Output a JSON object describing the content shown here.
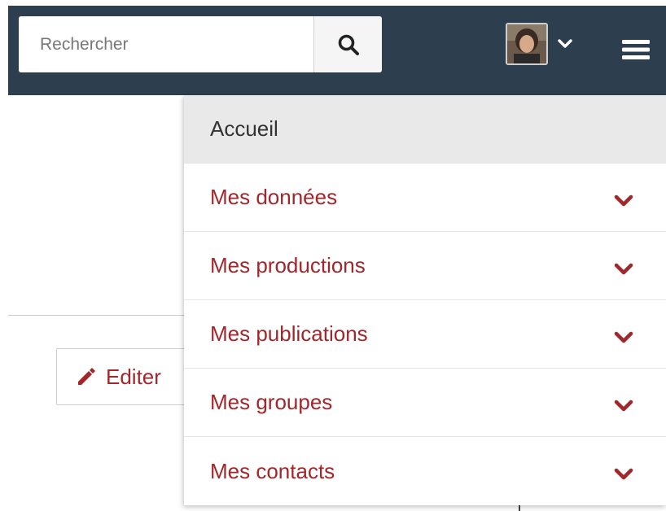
{
  "search": {
    "placeholder": "Rechercher",
    "button_icon": "search-icon"
  },
  "user_menu": {
    "avatar_icon": "avatar",
    "chevron_icon": "chevron-down-icon"
  },
  "hamburger_icon": "hamburger-icon",
  "edit": {
    "label": "Editer",
    "icon": "pencil-icon"
  },
  "menu": {
    "items": [
      {
        "label": "Accueil"
      },
      {
        "label": "Mes données"
      },
      {
        "label": "Mes productions"
      },
      {
        "label": "Mes publications"
      },
      {
        "label": "Mes groupes"
      },
      {
        "label": "Mes contacts"
      }
    ]
  },
  "colors": {
    "header_bg": "#2d3e4f",
    "accent": "#a3262a",
    "home_bg": "#e9e9e9"
  }
}
